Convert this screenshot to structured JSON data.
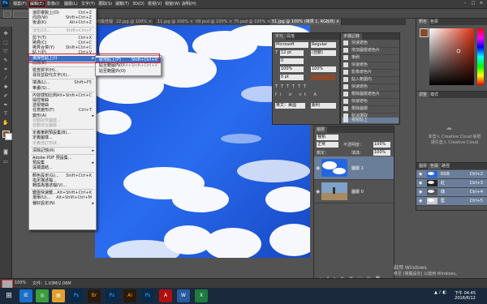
{
  "menubar": {
    "logo": "Ps",
    "items": [
      "檔案(F)",
      "編輯(E)",
      "影像(I)",
      "圖層(L)",
      "文字(Y)",
      "選取(S)",
      "濾鏡(T)",
      "3D(D)",
      "檢視(V)",
      "視窗(W)",
      "說明(H)"
    ],
    "window_controls": [
      "–",
      "□",
      "✕"
    ]
  },
  "tabs": [
    {
      "label": "的最佳檔",
      "active": false
    },
    {
      "label": "22.jpg @ 100% ×",
      "active": false
    },
    {
      "label": "11.jpg @ 100% ×",
      "active": false
    },
    {
      "label": "09.psd @ 100% ×",
      "active": false
    },
    {
      "label": "75.psd @ 100% ×",
      "active": false
    },
    {
      "label": "51.jpg @ 100% (拷貝 1, RGB/8) ×",
      "active": true
    }
  ],
  "edit_menu": {
    "items": [
      {
        "label": "還原複製上(O)",
        "shortcut": "Ctrl+Z",
        "state": "normal"
      },
      {
        "label": "向前(W)",
        "shortcut": "Shift+Ctrl+Z",
        "state": "normal"
      },
      {
        "label": "後退(K)",
        "shortcut": "Alt+Ctrl+Z",
        "state": "normal"
      },
      {
        "sep": true
      },
      {
        "label": "淡化(D)...",
        "shortcut": "Shift+Ctrl+F",
        "state": "disabled"
      },
      {
        "sep": true
      },
      {
        "label": "剪下(T)",
        "shortcut": "Ctrl+X",
        "state": "normal"
      },
      {
        "label": "拷貝(C)",
        "shortcut": "Ctrl+C",
        "state": "normal"
      },
      {
        "label": "拷貝合併(Y)",
        "shortcut": "Shift+Ctrl+C",
        "state": "normal"
      },
      {
        "label": "貼上(P)",
        "shortcut": "Ctrl+V",
        "state": "normal"
      },
      {
        "label": "選擇性貼上(I)",
        "shortcut": "",
        "state": "highlighted",
        "submenu": true
      },
      {
        "label": "清除(E)",
        "shortcut": "",
        "state": "normal"
      },
      {
        "sep": true
      },
      {
        "label": "檢查拼字(H)...",
        "shortcut": "",
        "state": "normal"
      },
      {
        "label": "尋找並取代文字(X)...",
        "shortcut": "",
        "state": "normal"
      },
      {
        "sep": true
      },
      {
        "label": "填滿(L)...",
        "shortcut": "Shift+F5",
        "state": "normal"
      },
      {
        "label": "筆畫(S)...",
        "shortcut": "",
        "state": "normal"
      },
      {
        "sep": true
      },
      {
        "label": "內容感知比例",
        "shortcut": "Alt+Shift+Ctrl+C",
        "state": "normal"
      },
      {
        "label": "操控彎曲",
        "shortcut": "",
        "state": "normal"
      },
      {
        "label": "透視彎曲",
        "shortcut": "",
        "state": "normal"
      },
      {
        "label": "任意變形(F)",
        "shortcut": "Ctrl+T",
        "state": "normal"
      },
      {
        "label": "變形(A)",
        "shortcut": "",
        "state": "normal",
        "submenu": true
      },
      {
        "label": "自動對齊圖層...",
        "shortcut": "",
        "state": "disabled"
      },
      {
        "label": "自動混合圖層...",
        "shortcut": "",
        "state": "disabled"
      },
      {
        "sep": true
      },
      {
        "label": "定義筆刷預設集(B)...",
        "shortcut": "",
        "state": "normal"
      },
      {
        "label": "定義圖樣...",
        "shortcut": "",
        "state": "normal"
      },
      {
        "label": "定義自訂形狀...",
        "shortcut": "",
        "state": "disabled"
      },
      {
        "sep": true
      },
      {
        "label": "清除記憶(R)",
        "shortcut": "",
        "state": "normal",
        "submenu": true
      },
      {
        "sep": true
      },
      {
        "label": "Adobe PDF 預設集...",
        "shortcut": "",
        "state": "normal"
      },
      {
        "label": "預設集",
        "shortcut": "",
        "state": "normal",
        "submenu": true
      },
      {
        "label": "遠端連結...",
        "shortcut": "",
        "state": "normal"
      },
      {
        "sep": true
      },
      {
        "label": "顏色設定(G)...",
        "shortcut": "Shift+Ctrl+K",
        "state": "normal"
      },
      {
        "label": "指定描述檔...",
        "shortcut": "",
        "state": "normal"
      },
      {
        "label": "轉換為描述檔(V)...",
        "shortcut": "",
        "state": "normal"
      },
      {
        "sep": true
      },
      {
        "label": "鍵盤快速鍵...",
        "shortcut": "Alt+Shift+Ctrl+K",
        "state": "normal"
      },
      {
        "label": "選單(U)...",
        "shortcut": "Alt+Shift+Ctrl+M",
        "state": "normal"
      },
      {
        "label": "偏好設定(N)",
        "shortcut": "",
        "state": "normal",
        "submenu": true
      }
    ]
  },
  "paste_special_submenu": {
    "items": [
      {
        "label": "就地貼上(P)",
        "shortcut": "Shift+Ctrl+V",
        "state": "highlighted"
      },
      {
        "label": "貼至範圍內(I)",
        "shortcut": "Alt+Shift+Ctrl+V",
        "state": "normal"
      },
      {
        "label": "貼至範圍外(O)",
        "shortcut": "",
        "state": "normal"
      }
    ]
  },
  "character_panel": {
    "tabs": [
      "字元",
      "段落"
    ],
    "font": "Microsoft JhengHei",
    "style": "Regular",
    "size": "12 pt",
    "leading": "(自動)",
    "tracking": "0",
    "scale": "100%",
    "baseline": "0 pt",
    "language": "英文：美國",
    "antialias": "銳利",
    "color": "#8a4a2c"
  },
  "history_panel": {
    "tabs": [
      "步驟記錄"
    ],
    "items": [
      "快速遮色",
      "增加圖層遮色片",
      "筆刷",
      "快速遮色",
      "影像遮色片",
      "貼入範圍內",
      "快速遮色",
      "刪除圖層遮色片",
      "快速遮色",
      "刪除圖層",
      "取消選取",
      "複製貼上"
    ],
    "selected_index": 11
  },
  "layers_panel": {
    "tabs": [
      "圖層"
    ],
    "kind_filter": "種類",
    "blend_mode": "正常",
    "opacity_label": "不透明度：",
    "opacity": "100%",
    "lock_label": "鎖定：",
    "fill_label": "填滿：",
    "fill": "100%",
    "layers": [
      {
        "name": "圖層 1",
        "selected": true
      },
      {
        "name": "圖層 0",
        "selected": false
      }
    ]
  },
  "color_panel": {
    "tabs": [
      "顏色",
      "色票"
    ]
  },
  "swatch_panel": {
    "tabs": [
      "調整",
      "樣式"
    ],
    "cc_line1": "未登入 Creative Cloud 帳號",
    "cc_line2": "請先登入 Creative Cloud"
  },
  "channels_panel": {
    "tabs": [
      "圖層",
      "色版",
      "路徑"
    ],
    "channels": [
      {
        "name": "RGB",
        "shortcut": "Ctrl+2",
        "selected": true
      },
      {
        "name": "紅",
        "shortcut": "Ctrl+3",
        "selected": true
      },
      {
        "name": "綠",
        "shortcut": "Ctrl+4",
        "selected": true
      },
      {
        "name": "藍",
        "shortcut": "Ctrl+5",
        "selected": true
      }
    ]
  },
  "statusbar": {
    "zoom": "100%",
    "doc": "文件：1.03M/2.06M"
  },
  "watermark": {
    "line1": "啟用 Windows",
    "line2": "移至 [電腦設定] 以啟用 Windows。"
  },
  "taskbar": {
    "apps": [
      "IE",
      "Chrome",
      "Ps",
      "Br",
      "Ps",
      "Ai",
      "Ps",
      "Acrobat",
      "Word",
      "Excel"
    ],
    "clock_time": "下午 04:45",
    "clock_date": "2016/6/12"
  },
  "colors": {
    "selection": "#3f6fc4",
    "highlight_box": "#d0202a",
    "foreground": "#8a4a2c",
    "sky": "#1f5fe0"
  }
}
